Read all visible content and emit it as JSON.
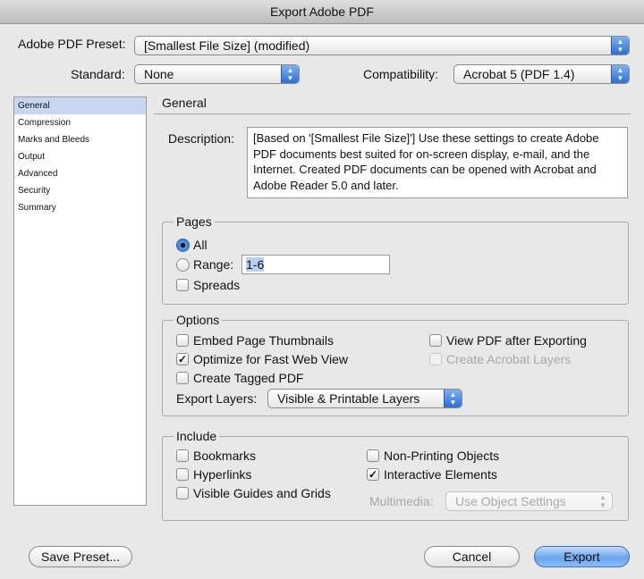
{
  "window": {
    "title": "Export Adobe PDF"
  },
  "preset": {
    "label": "Adobe PDF Preset:",
    "value": "[Smallest File Size] (modified)"
  },
  "standard": {
    "label": "Standard:",
    "value": "None"
  },
  "compatibility": {
    "label": "Compatibility:",
    "value": "Acrobat 5 (PDF 1.4)"
  },
  "sidebar": {
    "items": [
      {
        "label": "General",
        "selected": true
      },
      {
        "label": "Compression",
        "selected": false
      },
      {
        "label": "Marks and Bleeds",
        "selected": false
      },
      {
        "label": "Output",
        "selected": false
      },
      {
        "label": "Advanced",
        "selected": false
      },
      {
        "label": "Security",
        "selected": false
      },
      {
        "label": "Summary",
        "selected": false
      }
    ]
  },
  "general": {
    "title": "General",
    "description_label": "Description:",
    "description": "[Based on '[Smallest File Size]'] Use these settings to create Adobe PDF documents best suited for on-screen display, e-mail, and the Internet.  Created PDF documents can be opened with Acrobat and Adobe Reader 5.0 and later."
  },
  "pages": {
    "title": "Pages",
    "all_label": "All",
    "all_selected": true,
    "range_label": "Range:",
    "range_value": "1-6",
    "spreads_label": "Spreads",
    "spreads_checked": false
  },
  "options": {
    "title": "Options",
    "embed_thumbnails": {
      "label": "Embed Page Thumbnails",
      "checked": false
    },
    "optimize_web": {
      "label": "Optimize for Fast Web View",
      "checked": true
    },
    "tagged_pdf": {
      "label": "Create Tagged PDF",
      "checked": false
    },
    "view_after": {
      "label": "View PDF after Exporting",
      "checked": false
    },
    "acrobat_layers": {
      "label": "Create Acrobat Layers",
      "checked": false,
      "disabled": true
    },
    "export_layers_label": "Export Layers:",
    "export_layers_value": "Visible & Printable Layers"
  },
  "include": {
    "title": "Include",
    "bookmarks": {
      "label": "Bookmarks",
      "checked": false
    },
    "hyperlinks": {
      "label": "Hyperlinks",
      "checked": false
    },
    "guides": {
      "label": "Visible Guides and Grids",
      "checked": false
    },
    "non_printing": {
      "label": "Non-Printing Objects",
      "checked": false
    },
    "interactive": {
      "label": "Interactive Elements",
      "checked": true
    },
    "multimedia_label": "Multimedia:",
    "multimedia_value": "Use Object Settings"
  },
  "buttons": {
    "save_preset": "Save Preset...",
    "cancel": "Cancel",
    "export": "Export"
  },
  "icons": {
    "popup_arrows": "▲▼",
    "check": "✓"
  }
}
